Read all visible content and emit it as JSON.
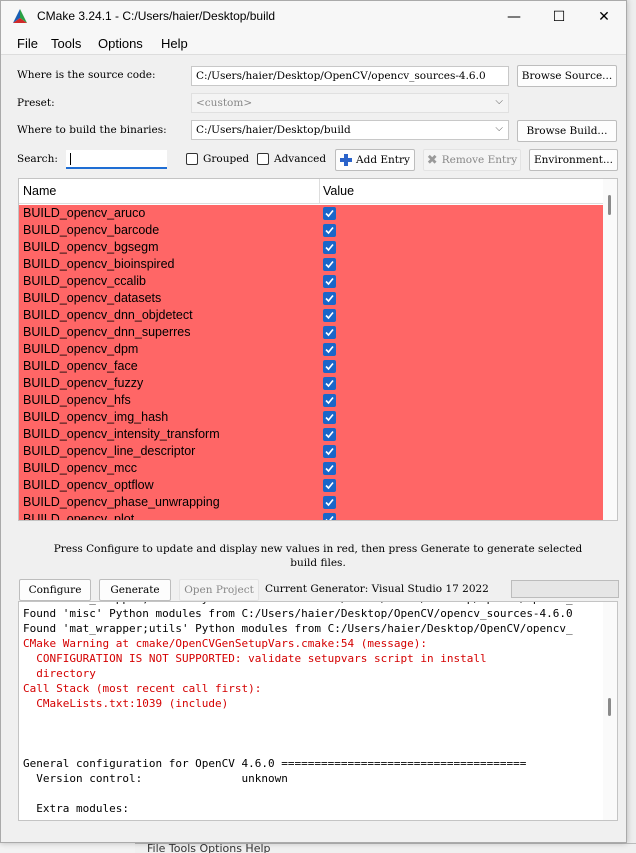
{
  "window": {
    "title": "CMake 3.24.1 - C:/Users/haier/Desktop/build",
    "controls": {
      "minimize": "—",
      "maximize": "☐",
      "close": "✕"
    }
  },
  "menu": [
    "File",
    "Tools",
    "Options",
    "Help"
  ],
  "source": {
    "label": "Where is the source code:",
    "value": "C:/Users/haier/Desktop/OpenCV/opencv_sources-4.6.0",
    "button": "Browse Source..."
  },
  "preset": {
    "label": "Preset:",
    "value": "<custom>"
  },
  "binaries": {
    "label": "Where to build the binaries:",
    "value": "C:/Users/haier/Desktop/build",
    "button": "Browse Build..."
  },
  "search": {
    "label": "Search:",
    "value": ""
  },
  "options": {
    "grouped": "Grouped",
    "advanced": "Advanced",
    "add_entry": "Add Entry",
    "remove_entry": "Remove Entry",
    "environment": "Environment..."
  },
  "table": {
    "headers": [
      "Name",
      "Value"
    ],
    "row_color": "#ff6666",
    "rows": [
      {
        "name": "BUILD_opencv_aruco",
        "checked": true
      },
      {
        "name": "BUILD_opencv_barcode",
        "checked": true
      },
      {
        "name": "BUILD_opencv_bgsegm",
        "checked": true
      },
      {
        "name": "BUILD_opencv_bioinspired",
        "checked": true
      },
      {
        "name": "BUILD_opencv_ccalib",
        "checked": true
      },
      {
        "name": "BUILD_opencv_datasets",
        "checked": true
      },
      {
        "name": "BUILD_opencv_dnn_objdetect",
        "checked": true
      },
      {
        "name": "BUILD_opencv_dnn_superres",
        "checked": true
      },
      {
        "name": "BUILD_opencv_dpm",
        "checked": true
      },
      {
        "name": "BUILD_opencv_face",
        "checked": true
      },
      {
        "name": "BUILD_opencv_fuzzy",
        "checked": true
      },
      {
        "name": "BUILD_opencv_hfs",
        "checked": true
      },
      {
        "name": "BUILD_opencv_img_hash",
        "checked": true
      },
      {
        "name": "BUILD_opencv_intensity_transform",
        "checked": true
      },
      {
        "name": "BUILD_opencv_line_descriptor",
        "checked": true
      },
      {
        "name": "BUILD_opencv_mcc",
        "checked": true
      },
      {
        "name": "BUILD_opencv_optflow",
        "checked": true
      },
      {
        "name": "BUILD_opencv_phase_unwrapping",
        "checked": true
      },
      {
        "name": "BUILD_opencv_plot",
        "checked": true
      }
    ]
  },
  "hint": {
    "line1": "Press Configure to update and display new values in red, then press Generate to generate selected",
    "line2": "build files."
  },
  "actions": {
    "configure": "Configure",
    "generate": "Generate",
    "open_project": "Open Project",
    "generator": "Current Generator: Visual Studio 17 2022"
  },
  "console": [
    {
      "text": "Found 'mat_wrapper;utils' Python modules from C:/Users/haier/Desktop/OpenCV/opencv_",
      "color": "black"
    },
    {
      "text": "Found 'misc' Python modules from C:/Users/haier/Desktop/OpenCV/opencv_sources-4.6.0",
      "color": "black"
    },
    {
      "text": "Found 'mat_wrapper;utils' Python modules from C:/Users/haier/Desktop/OpenCV/opencv_",
      "color": "black"
    },
    {
      "text": "CMake Warning at cmake/OpenCVGenSetupVars.cmake:54 (message):",
      "color": "red"
    },
    {
      "text": "  CONFIGURATION IS NOT SUPPORTED: validate setupvars script in install",
      "color": "red"
    },
    {
      "text": "  directory",
      "color": "red"
    },
    {
      "text": "Call Stack (most recent call first):",
      "color": "red"
    },
    {
      "text": "  CMakeLists.txt:1039 (include)",
      "color": "red"
    },
    {
      "text": "",
      "color": "black"
    },
    {
      "text": "",
      "color": "black"
    },
    {
      "text": "",
      "color": "black"
    },
    {
      "text": "General configuration for OpenCV 4.6.0 =====================================",
      "color": "black"
    },
    {
      "text": "  Version control:               unknown",
      "color": "black"
    },
    {
      "text": "",
      "color": "black"
    },
    {
      "text": "  Extra modules:",
      "color": "black"
    }
  ],
  "background_menu": "File   Tools   Options   Help"
}
